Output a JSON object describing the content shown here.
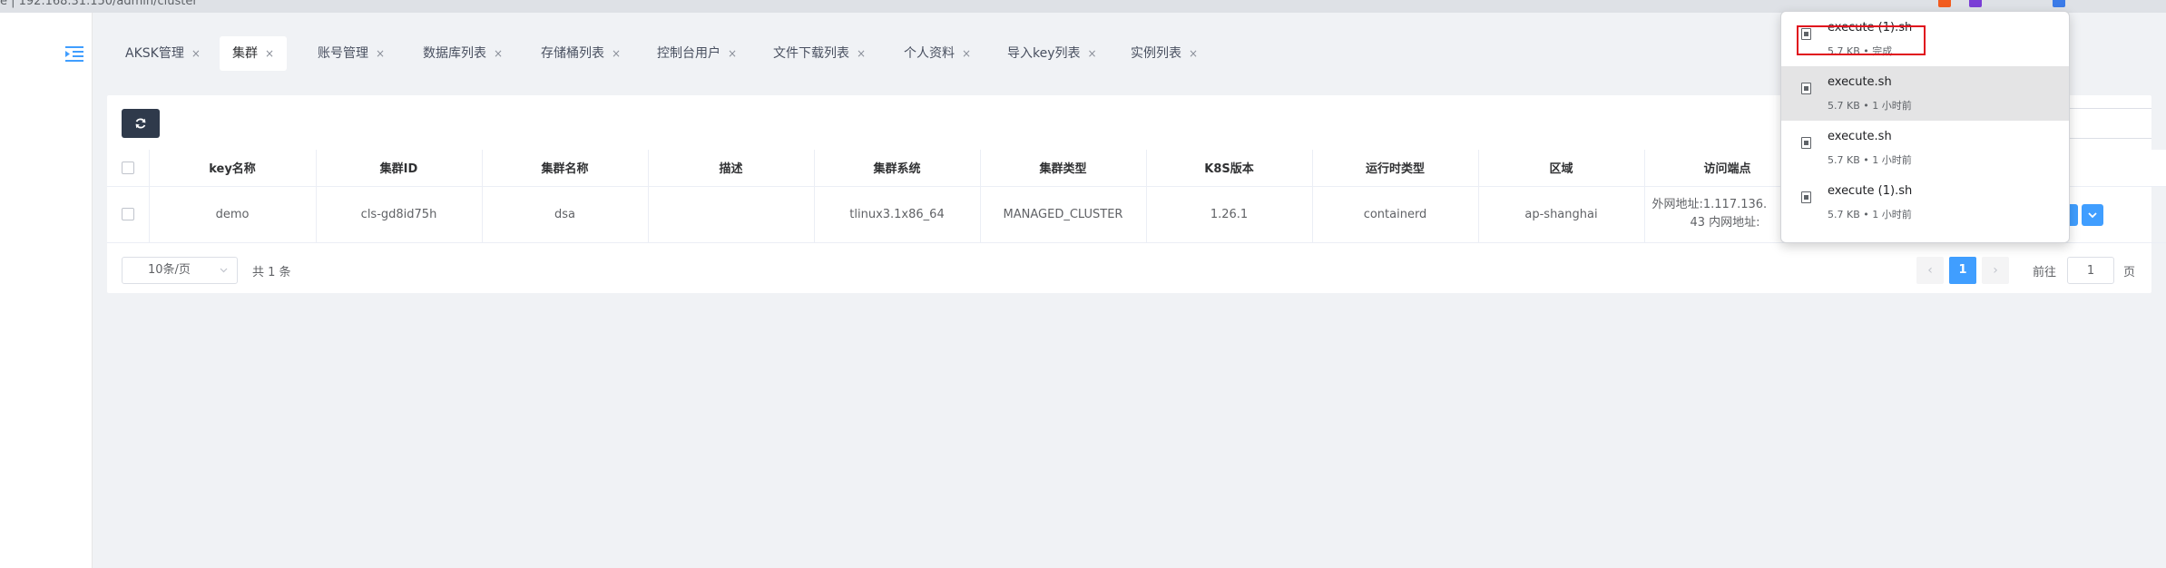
{
  "browser": {
    "url_fragment": "e |  192.168.31.150/admin/cluster"
  },
  "tabs": [
    {
      "label": "AKSK管理"
    },
    {
      "label": "集群",
      "active": true
    },
    {
      "label": "账号管理"
    },
    {
      "label": "数据库列表"
    },
    {
      "label": "存储桶列表"
    },
    {
      "label": "控制台用户"
    },
    {
      "label": "文件下载列表"
    },
    {
      "label": "个人资料"
    },
    {
      "label": "导入key列表"
    },
    {
      "label": "实例列表"
    }
  ],
  "tab_close_glyph": "×",
  "table": {
    "columns": [
      "key名称",
      "集群ID",
      "集群名称",
      "描述",
      "集群系统",
      "集群类型",
      "K8S版本",
      "运行时类型",
      "区域",
      "访问端点"
    ],
    "rows": [
      {
        "key_name": "demo",
        "cluster_id": "cls-gd8id75h",
        "cluster_name": "dsa",
        "description": "",
        "cluster_os": "tlinux3.1x86_64",
        "cluster_type": "MANAGED_CLUSTER",
        "k8s_version": "1.26.1",
        "runtime": "containerd",
        "region": "ap-shanghai",
        "endpoint_line1": "外网地址:1.117.136.",
        "endpoint_line2": "43 内网地址:"
      }
    ]
  },
  "pagination": {
    "page_size": "10条/页",
    "total": "共 1 条",
    "current_page": "1",
    "goto_prefix": "前往",
    "goto_value": "1",
    "goto_suffix": "页",
    "prev": "‹",
    "next": "›"
  },
  "downloads": [
    {
      "name": "execute (1).sh",
      "meta": "5.7 KB • 完成"
    },
    {
      "name": "execute.sh",
      "meta": "5.7 KB • 1 小时前"
    },
    {
      "name": "execute.sh",
      "meta": "5.7 KB • 1 小时前"
    },
    {
      "name": "execute (1).sh",
      "meta": "5.7 KB • 1 小时前"
    }
  ],
  "colors": {
    "primary": "#409eff",
    "refresh_button": "#2f3a4b",
    "highlight": "#e0101d"
  }
}
